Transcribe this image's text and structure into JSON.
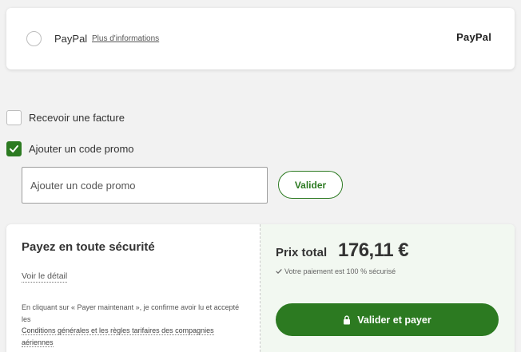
{
  "paypal": {
    "label": "PayPal",
    "more_link": "Plus d'informations",
    "logo_text": "PayPal"
  },
  "options": {
    "invoice_label": "Recevoir une facture",
    "invoice_checked": false,
    "promo_label": "Ajouter un code promo",
    "promo_checked": true
  },
  "promo": {
    "placeholder": "Ajouter un code promo",
    "value": "",
    "validate_label": "Valider"
  },
  "payment": {
    "title": "Payez en toute sécurité",
    "detail_link": "Voir le détail",
    "legal_prefix": "En cliquant sur « Payer maintenant », je confirme avoir lu et accepté les",
    "legal_link": "Conditions générales et les règles tarifaires des compagnies aériennes",
    "total_label": "Prix total",
    "total_value": "176,11 €",
    "secure_note": "Votre paiement est 100 % sécurisé",
    "pay_button": "Valider et payer"
  },
  "colors": {
    "accent": "#2c7a21",
    "summary_bg": "#f2f8f1",
    "page_bg": "#f2f2f2"
  },
  "icons": {
    "radio": "radio-unselected-icon",
    "checkmark": "check-icon",
    "lock": "lock-icon"
  }
}
